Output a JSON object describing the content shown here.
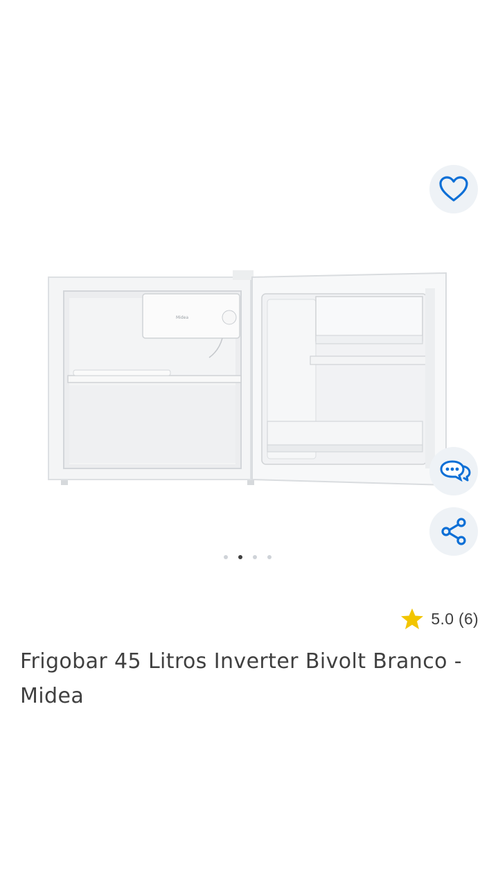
{
  "gallery": {
    "image_alt": "Frigobar aberto",
    "icon_names": {
      "favorite": "heart-icon",
      "chat": "chat-bubbles-icon",
      "share": "share-icon"
    },
    "dots_count": 4,
    "active_dot": 2
  },
  "product": {
    "rating": "5.0 (6)",
    "title": "Frigobar 45 Litros Inverter Bivolt Branco - Midea"
  },
  "colors": {
    "accent": "#0c6fd6",
    "star": "#f2c500",
    "text": "#404040",
    "fab_bg": "#eef2f6"
  }
}
